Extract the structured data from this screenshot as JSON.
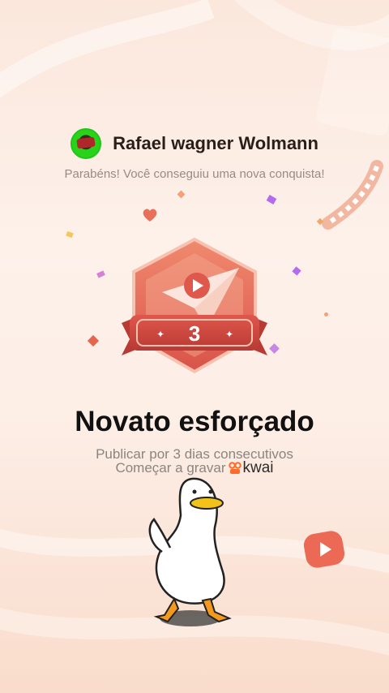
{
  "user": {
    "name": "Rafael wagner Wolmann"
  },
  "message": "Parabéns! Você conseguiu uma nova conquista!",
  "badge": {
    "number": "3"
  },
  "achievement": {
    "title": "Novato esforçado",
    "description": "Publicar por 3 dias consecutivos",
    "cta": "Começar a gravar",
    "brand": "kwai"
  },
  "colors": {
    "badge_red": "#d9534a",
    "badge_dark": "#b83a34",
    "brand_orange": "#ff6b2b"
  }
}
